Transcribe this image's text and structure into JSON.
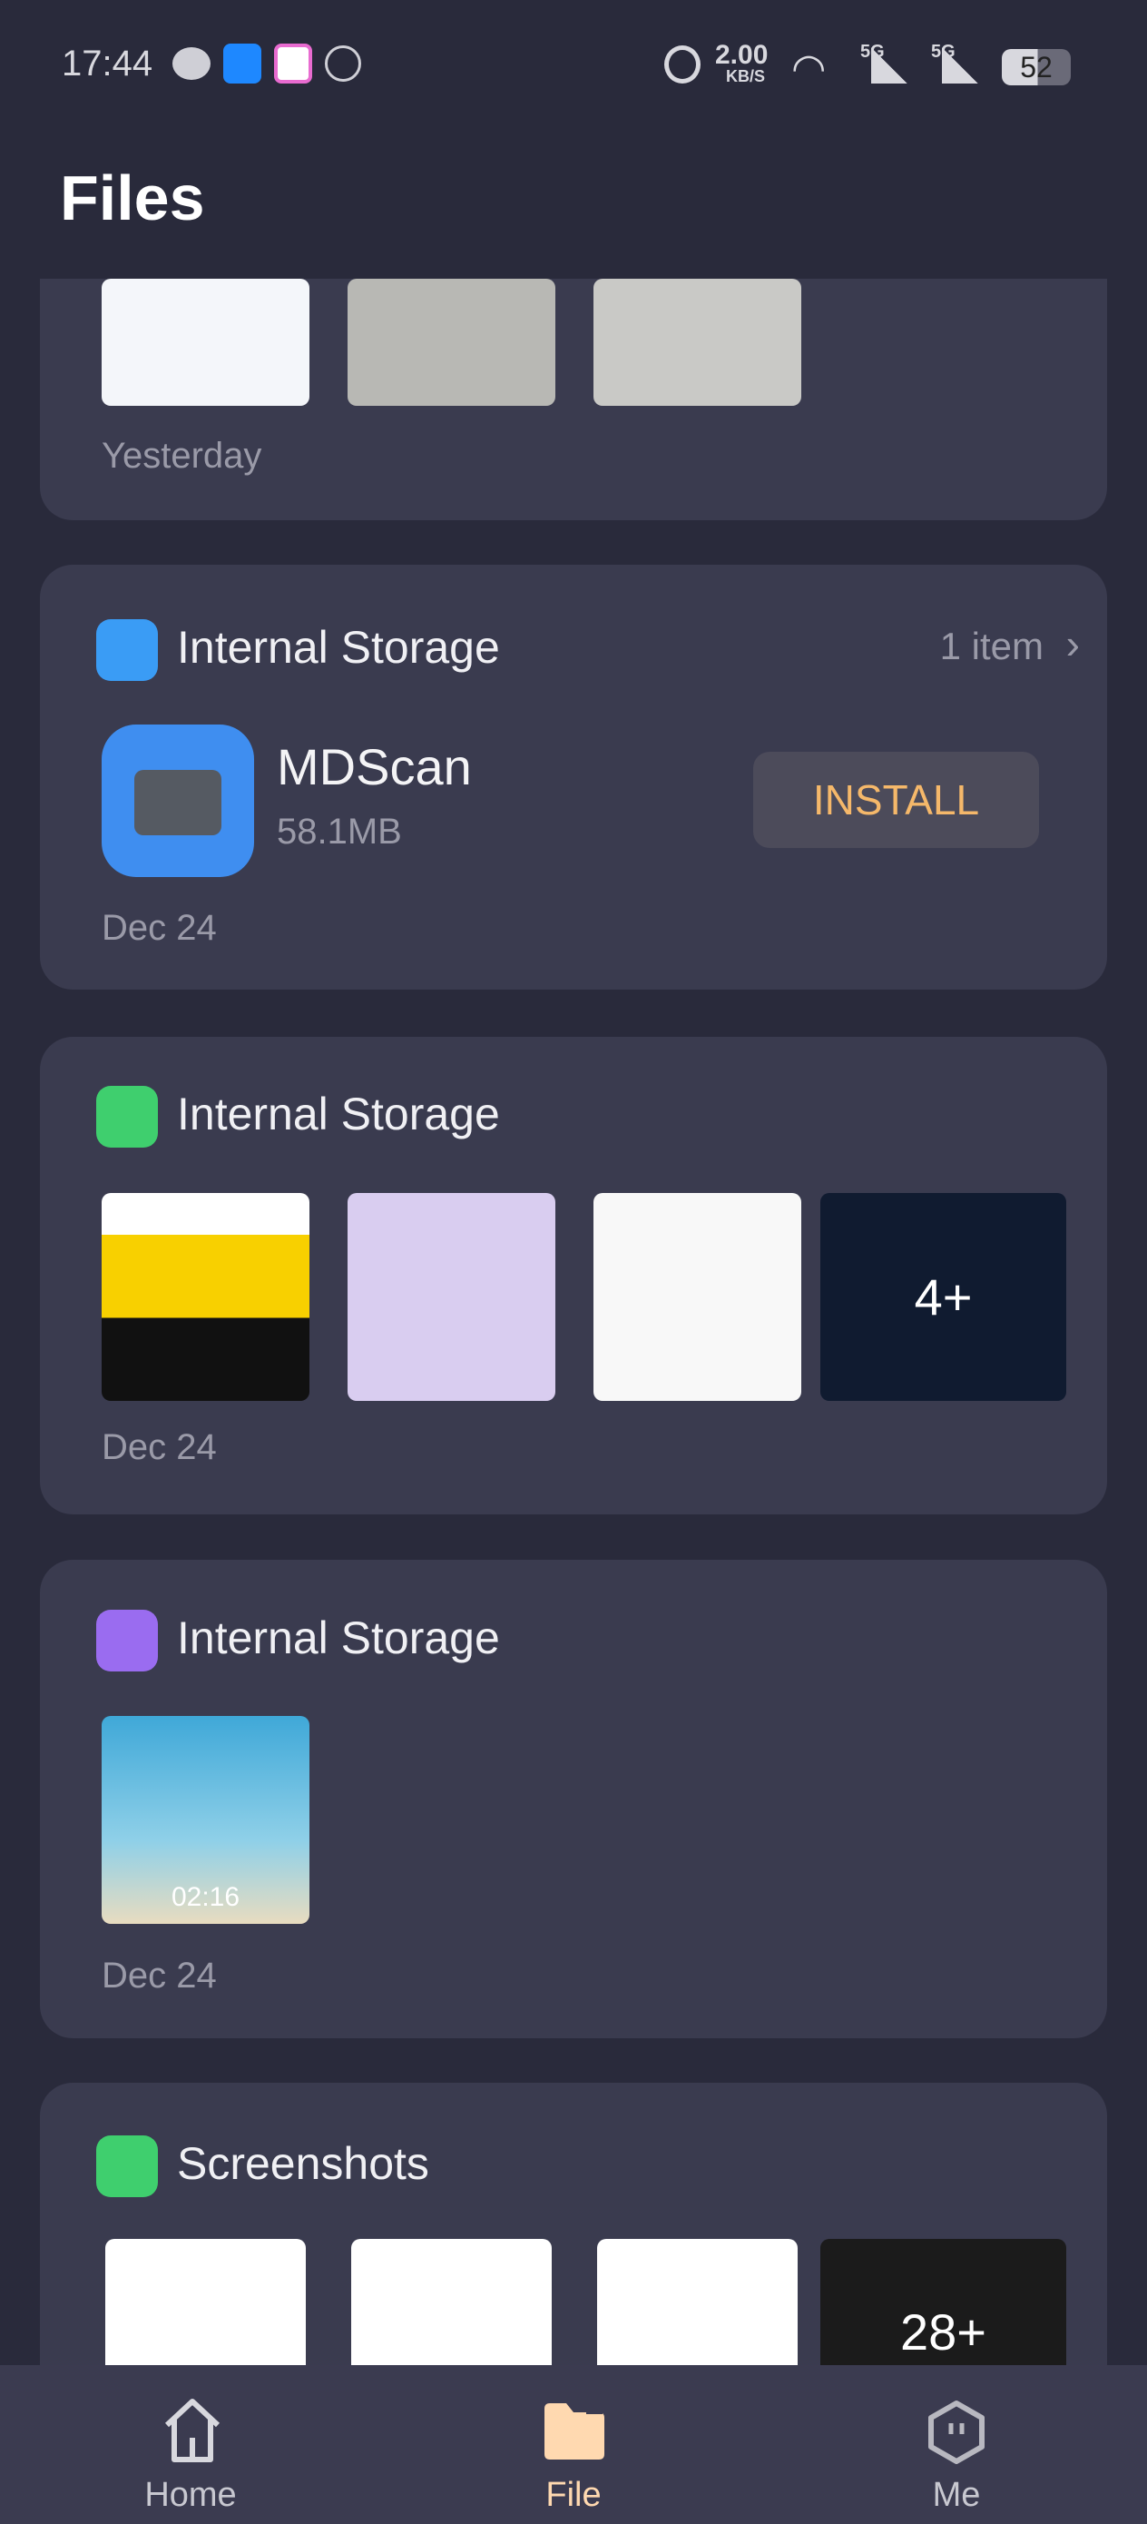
{
  "status_bar": {
    "time": "17:44",
    "net_speed": "2.00",
    "net_unit": "KB/S",
    "network1": "5G",
    "network2": "5G",
    "battery": "52"
  },
  "header": {
    "title": "Files"
  },
  "cards": [
    {
      "date": "Yesterday"
    },
    {
      "title": "Internal Storage",
      "count": "1 item",
      "app": {
        "name": "MDScan",
        "size": "58.1MB",
        "action": "INSTALL"
      },
      "date": "Dec 24"
    },
    {
      "title": "Internal Storage",
      "more": "4+",
      "date": "Dec 24"
    },
    {
      "title": "Internal Storage",
      "duration": "02:16",
      "date": "Dec 24"
    },
    {
      "title": "Screenshots",
      "more": "28+"
    }
  ],
  "nav": {
    "items": [
      {
        "label": "Home"
      },
      {
        "label": "File"
      },
      {
        "label": "Me"
      }
    ],
    "active_color": "#ffd9b0"
  },
  "colors": {
    "accent": "#f5b86a",
    "background": "#292a3b",
    "card": "#3a3b4f"
  }
}
